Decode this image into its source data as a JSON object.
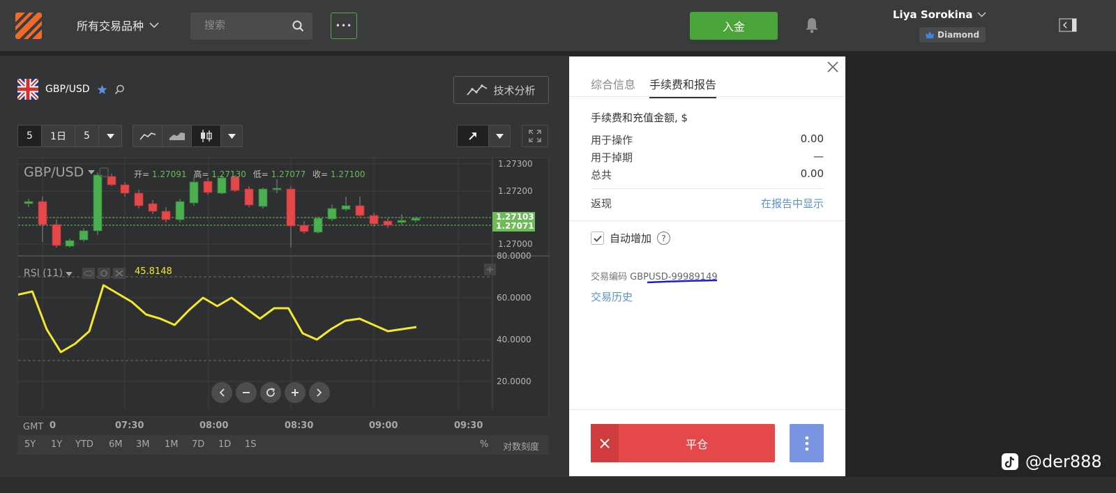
{
  "topbar": {
    "instruments_label": "所有交易品种",
    "search_placeholder": "搜索",
    "more_label": "•••",
    "deposit_label": "入金",
    "user_name": "Liya Sorokina",
    "user_level": "Diamond"
  },
  "chart_header": {
    "symbol": "GBP/USD",
    "tech_analysis_label": "技术分析"
  },
  "toolbar": {
    "period_a": "5",
    "period_b": "1日",
    "period_c": "5"
  },
  "chart": {
    "title": "GBP/USD",
    "open_label": "开=",
    "open": "1.27091",
    "high_label": "高=",
    "high": "1.27130",
    "low_label": "低=",
    "low": "1.27077",
    "close_label": "收=",
    "close": "1.27100",
    "price_ticks": [
      "1.27300",
      "1.27200",
      "1.27000"
    ],
    "price_tag_1": "1.27103",
    "price_tag_2": "1.27071",
    "rsi_title": "RSI (11)",
    "rsi_value": "45.8148",
    "rsi_ticks": [
      "80.0000",
      "60.0000",
      "40.0000",
      "20.0000"
    ],
    "gmt_label": "GMT",
    "time_ticks": [
      "0",
      "07:30",
      "08:00",
      "08:30",
      "09:00",
      "09:30"
    ],
    "ranges": [
      "5Y",
      "1Y",
      "YTD",
      "6M",
      "3M",
      "1M",
      "7D",
      "1D",
      "1S"
    ],
    "percent_label": "%",
    "log_scale_label": "对数刻度",
    "colors": {
      "up": "#4caf50",
      "down": "#e5484b",
      "rsi_line": "#f3e92a"
    }
  },
  "chart_data": {
    "type": "line",
    "title": "RSI (11)",
    "xlabel": "",
    "ylabel": "",
    "ylim": [
      0,
      100
    ],
    "x": [
      "06:58",
      "07:03",
      "07:08",
      "07:13",
      "07:18",
      "07:23",
      "07:28",
      "07:33",
      "07:38",
      "07:43",
      "07:48",
      "07:53",
      "07:58",
      "08:03",
      "08:08",
      "08:13",
      "08:18",
      "08:23",
      "08:28",
      "08:33",
      "08:38",
      "08:43",
      "08:48",
      "08:53",
      "08:58",
      "09:03",
      "09:08",
      "09:13",
      "09:18"
    ],
    "series": [
      {
        "values": [
          61.5,
          63,
          45,
          34,
          38,
          44,
          66,
          62,
          58,
          52,
          50,
          47,
          54,
          60,
          56,
          60,
          55,
          50,
          55,
          55,
          43,
          40,
          45,
          49,
          50,
          47,
          44,
          45,
          46
        ]
      }
    ]
  },
  "panel": {
    "tab_info": "综合信息",
    "tab_fees": "手续费和报告",
    "fees_title": "手续费和充值金额, $",
    "row_ops_label": "用于操作",
    "row_ops_value": "0.00",
    "row_roll_label": "用于掉期",
    "row_roll_value": "—",
    "row_total_label": "总共",
    "row_total_value": "0.00",
    "cashback_label": "返现",
    "cashback_link": "在报告中显示",
    "auto_increase_label": "自动增加",
    "trade_code_label": "交易编码",
    "trade_code": "GBPUSD-99989149",
    "history_link": "交易历史",
    "close_position_label": "平仓"
  },
  "watermark": "@der888"
}
